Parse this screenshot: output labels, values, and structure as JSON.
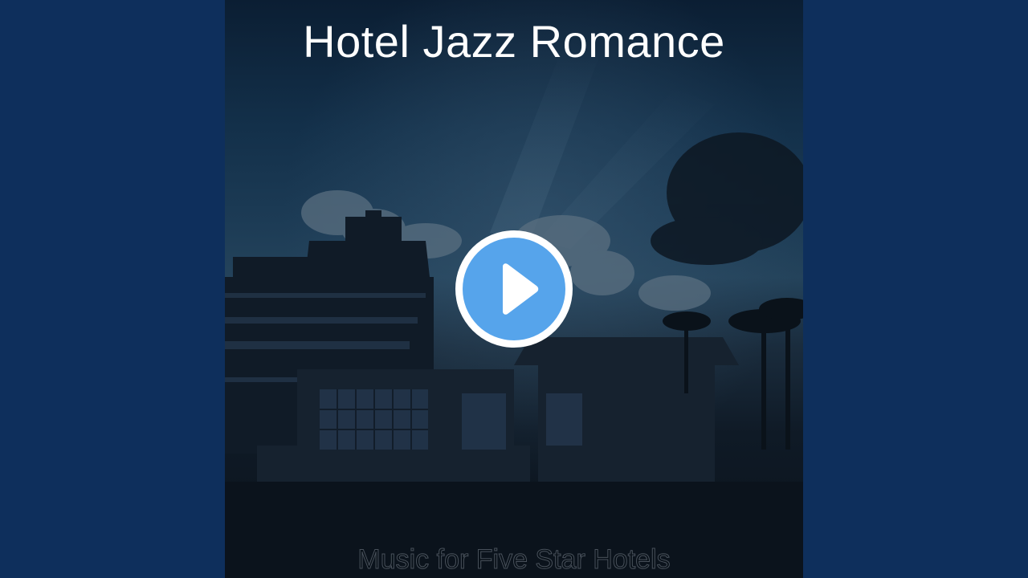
{
  "cover": {
    "title": "Hotel Jazz Romance",
    "subtitle": "Music for Five Star Hotels"
  },
  "player": {
    "play_icon": "play-icon"
  },
  "colors": {
    "side_background": "#0e2f5c",
    "play_fill": "#56a4eb",
    "play_ring": "#ffffff",
    "title_text": "#ffffff"
  }
}
